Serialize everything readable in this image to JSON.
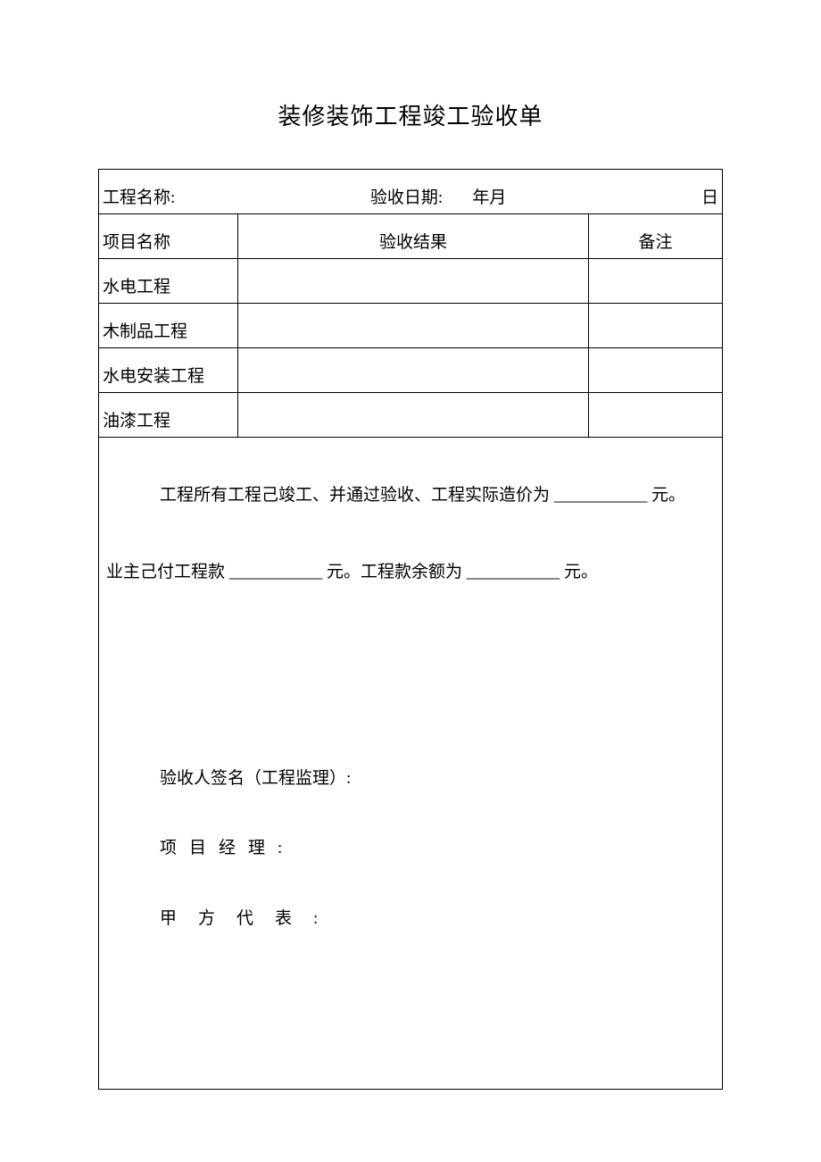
{
  "title": "装修装饰工程竣工验收单",
  "row1": {
    "name_label": "工程名称:",
    "date_label": "验收日期:",
    "ym": "年月",
    "d": "日"
  },
  "headers": {
    "item": "项目名称",
    "result": "验收结果",
    "remark": "备注"
  },
  "items": {
    "r1": "水电工程",
    "r2": "木制品工程",
    "r3": "水电安装工程",
    "r4": "油漆工程"
  },
  "body": {
    "p1a": "工程所有工程己竣工、并通过验收、工程实际造价为",
    "blank1": "___________",
    "yuan1": "元。",
    "p2a": "业主己付工程款",
    "blank2": "___________",
    "p2b": "元。工程款余额为",
    "blank3": "___________",
    "yuan2": "元。"
  },
  "signs": {
    "s1": "验收人签名（工程监理）:",
    "s2": "项目经理:",
    "s3": "甲方代表:"
  }
}
